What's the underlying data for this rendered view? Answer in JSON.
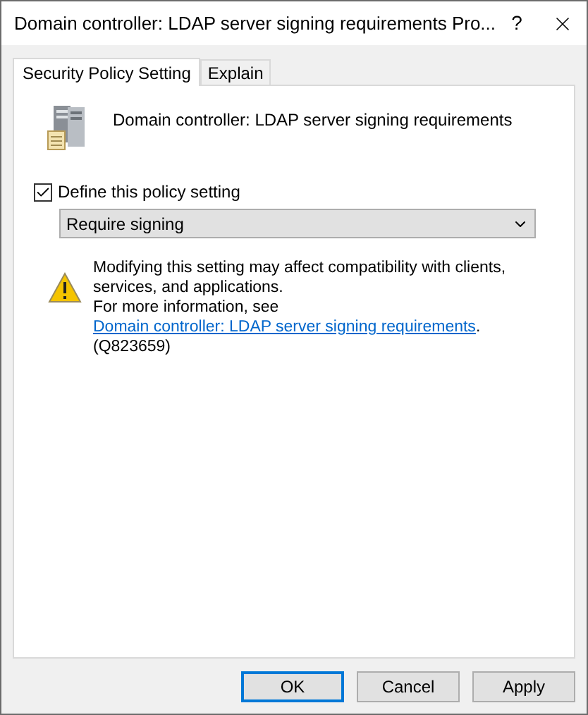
{
  "window": {
    "title": "Domain controller: LDAP server signing requirements Pro...",
    "help": "?"
  },
  "tabs": [
    {
      "label": "Security Policy Setting",
      "selected": true
    },
    {
      "label": "Explain",
      "selected": false
    }
  ],
  "policy": {
    "name": "Domain controller: LDAP server signing requirements"
  },
  "define_setting": {
    "label": "Define this policy setting",
    "checked": true
  },
  "dropdown": {
    "value": "Require signing"
  },
  "warning": {
    "text": "Modifying this setting may affect compatibility with clients, services, and applications.",
    "more_prefix": "For more information, see ",
    "link": "Domain controller: LDAP server signing requirements",
    "more_suffix": ". (Q823659)"
  },
  "buttons": [
    {
      "label": "OK",
      "default": true
    },
    {
      "label": "Cancel",
      "default": false
    },
    {
      "label": "Apply",
      "default": false
    }
  ]
}
